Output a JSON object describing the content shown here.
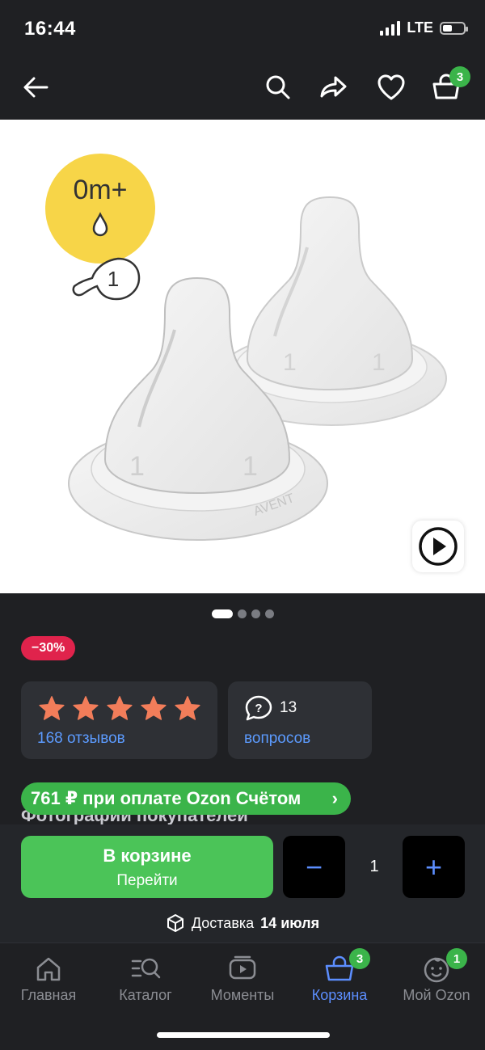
{
  "status_bar": {
    "time": "16:44",
    "network": "LTE",
    "battery_level": 0.45
  },
  "nav": {
    "cart_badge": "3",
    "icons": [
      "back-arrow-icon",
      "search-icon",
      "share-icon",
      "heart-icon",
      "basket-icon"
    ]
  },
  "product_image": {
    "age_label": "0m+",
    "flow_number": "1",
    "nipple_mark": "1",
    "brand_mark": "AVENT"
  },
  "gallery": {
    "total": 4,
    "active_index": 0
  },
  "discount": {
    "label": "−30%"
  },
  "rating": {
    "stars": 5,
    "reviews_label": "168 отзывов"
  },
  "questions": {
    "count": "13",
    "label": "вопросов"
  },
  "photos_title": "Фотографии покупателей",
  "ozon_offer": {
    "label": "761 ₽ при оплате Ozon Счётом"
  },
  "cart_button": {
    "main_label": "В корзине",
    "sub_label": "Перейти"
  },
  "quantity": {
    "minus": "−",
    "value": "1",
    "plus": "+"
  },
  "delivery": {
    "prefix": "Доставка",
    "date": "14 июля"
  },
  "tab_bar": {
    "items": [
      {
        "label": "Главная"
      },
      {
        "label": "Каталог"
      },
      {
        "label": "Моменты"
      },
      {
        "label": "Корзина",
        "badge": "3",
        "active": true
      },
      {
        "label": "Мой Ozon",
        "badge": "1"
      }
    ]
  },
  "colors": {
    "background": "#1f2023",
    "accent_blue": "#5c8eff",
    "green": "#3bb44a",
    "discount_red": "#e0234c",
    "star": "#f27d5a",
    "age_badge": "#f7d548"
  }
}
